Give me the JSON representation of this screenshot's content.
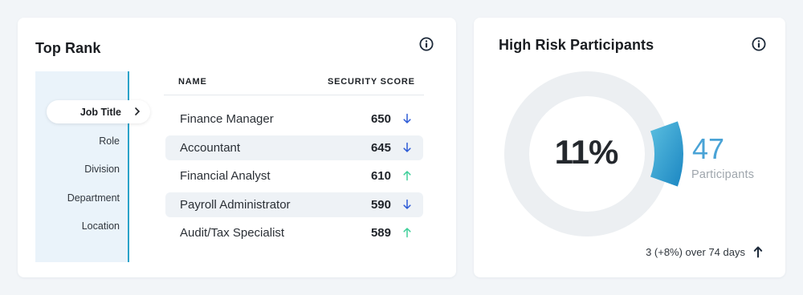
{
  "top_rank": {
    "title": "Top Rank",
    "nav": [
      {
        "label": "Job Title",
        "active": true
      },
      {
        "label": "Role",
        "active": false
      },
      {
        "label": "Division",
        "active": false
      },
      {
        "label": "Department",
        "active": false
      },
      {
        "label": "Location",
        "active": false
      }
    ],
    "columns": {
      "name": "NAME",
      "score": "SECURITY SCORE"
    },
    "rows": [
      {
        "name": "Finance Manager",
        "score": "650",
        "trend": "down"
      },
      {
        "name": "Accountant",
        "score": "645",
        "trend": "down"
      },
      {
        "name": "Financial Analyst",
        "score": "610",
        "trend": "up"
      },
      {
        "name": "Payroll Administrator",
        "score": "590",
        "trend": "down"
      },
      {
        "name": "Audit/Tax Specialist",
        "score": "589",
        "trend": "up"
      }
    ]
  },
  "high_risk": {
    "title": "High Risk Participants",
    "percent_label": "11%",
    "percent_value": 0.11,
    "count": "47",
    "count_label": "Participants",
    "trend_text": "3 (+8%) over 74 days",
    "trend_direction": "up"
  },
  "icons": {
    "info": "info-icon",
    "chevron": "chevron-right-icon",
    "down": "arrow-down-icon",
    "up": "arrow-up-icon"
  },
  "colors": {
    "accent": "#2aa3c9",
    "arrow_down": "#2d5bd6",
    "arrow_up": "#3fcf9a",
    "donut_track": "#eceff2",
    "donut_fill_start": "#5bbfe0",
    "donut_fill_end": "#1b86c2",
    "count_color": "#4aa3d6"
  }
}
